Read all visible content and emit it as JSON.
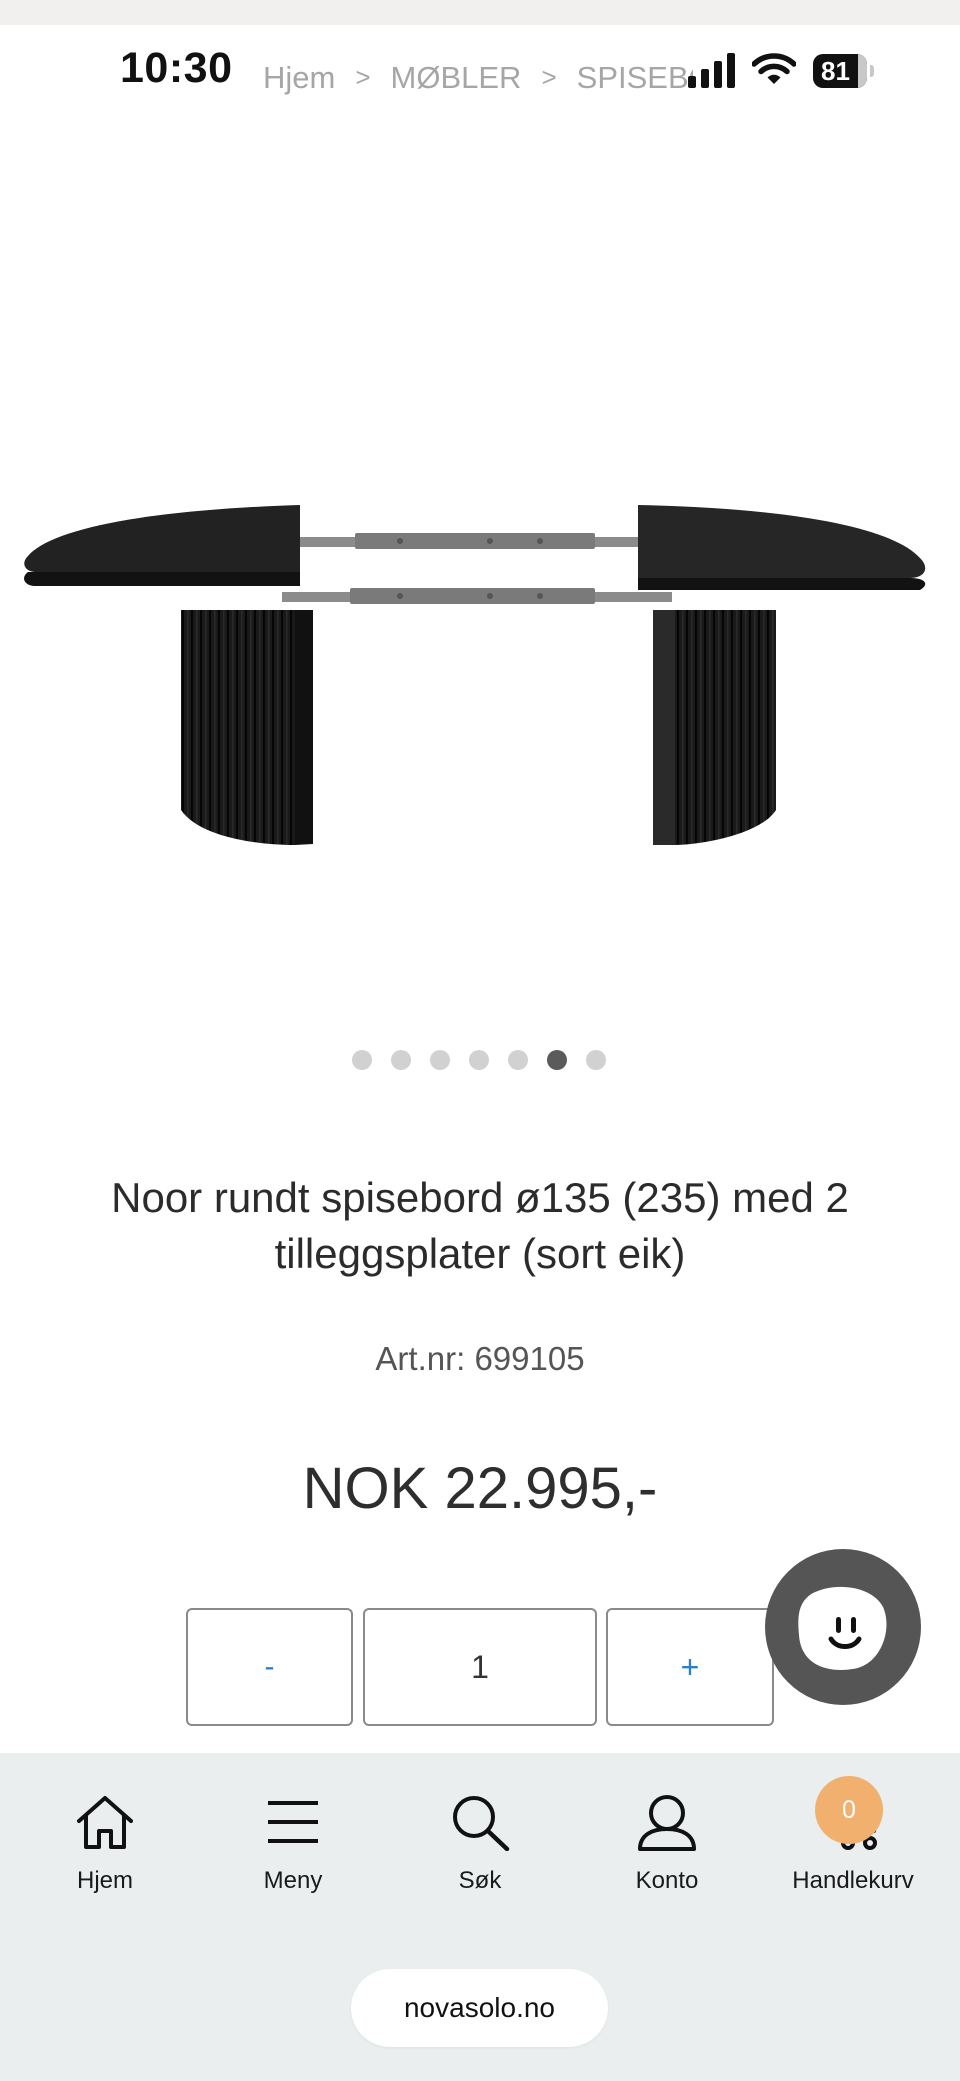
{
  "status_bar": {
    "time": "10:30",
    "battery": "81",
    "battery_level_pct": 81
  },
  "breadcrumb": {
    "items": [
      "Hjem",
      "MØBLER",
      "SPISEBORD"
    ],
    "separator": ">"
  },
  "gallery": {
    "image_count": 7,
    "active_index": 5
  },
  "product": {
    "title": "Noor rundt spisebord ø135 (235) med 2 tilleggsplater (sort eik)",
    "art_nr": "Art.nr: 699105",
    "price": "NOK 22.995,-"
  },
  "quantity": {
    "minus_label": "-",
    "value": "1",
    "plus_label": "+"
  },
  "bottom_nav": {
    "items": [
      {
        "label": "Hjem",
        "icon": "home-icon"
      },
      {
        "label": "Meny",
        "icon": "menu-icon"
      },
      {
        "label": "Søk",
        "icon": "search-icon"
      },
      {
        "label": "Konto",
        "icon": "user-icon"
      },
      {
        "label": "Handlekurv",
        "icon": "cart-icon"
      }
    ],
    "cart_count": "0"
  },
  "browser": {
    "url": "novasolo.no"
  },
  "colors": {
    "accent_blue": "#2b7fc9",
    "cart_badge": "#f1b06e",
    "nav_background": "#eaeeef",
    "chat_bubble": "#555555"
  }
}
